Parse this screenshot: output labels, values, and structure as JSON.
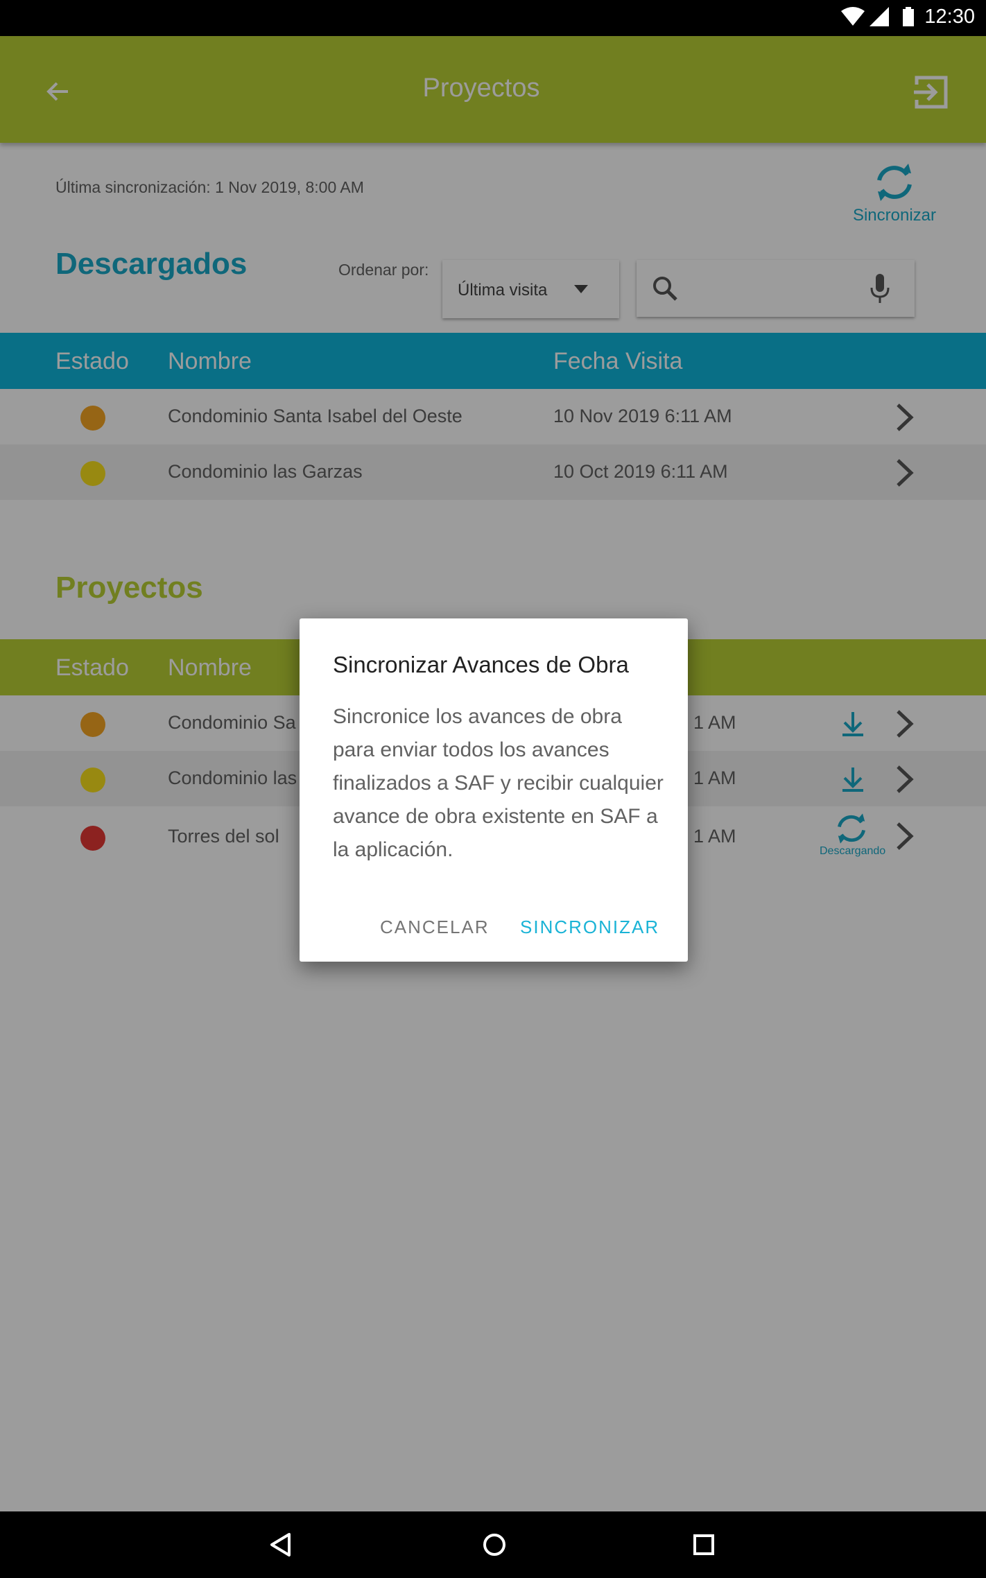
{
  "status_bar": {
    "time": "12:30"
  },
  "app_bar": {
    "title": "Proyectos"
  },
  "sync": {
    "last_sync": "Última sincronización: 1 Nov 2019, 8:00 AM",
    "button_label": "Sincronizar"
  },
  "downloaded": {
    "title": "Descargados",
    "order_label": "Ordenar por:",
    "order_value": "Última visita",
    "headers": {
      "estado": "Estado",
      "nombre": "Nombre",
      "fecha": "Fecha Visita"
    },
    "rows": [
      {
        "status_color": "#f5a623",
        "name": "Condominio Santa Isabel del Oeste",
        "date": "10 Nov 2019 6:11 AM"
      },
      {
        "status_color": "#f8e01c",
        "name": "Condominio las Garzas",
        "date": "10 Oct 2019 6:11 AM"
      }
    ]
  },
  "projects": {
    "title": "Proyectos",
    "headers": {
      "estado": "Estado",
      "nombre": "Nombre"
    },
    "rows": [
      {
        "status_color": "#f5a623",
        "name": "Condominio Sa",
        "date": "1 AM",
        "action": "download-icon"
      },
      {
        "status_color": "#f8e01c",
        "name": "Condominio las",
        "date": "1 AM",
        "action": "download-icon"
      },
      {
        "status_color": "#e53935",
        "name": "Torres del sol",
        "date": "1 AM",
        "action": "sync-icon",
        "action_label": "Descargando"
      }
    ]
  },
  "dialog": {
    "title": "Sincronizar Avances de Obra",
    "body": "Sincronice los avances de obra para enviar todos los avances finalizados a SAF y recibir cualquier avance de obra existente en SAF a la aplicación.",
    "cancel": "CANCELAR",
    "confirm": "SINCRONIZAR"
  },
  "colors": {
    "app_bar": "#b9d035",
    "downloaded_header": "#0fb5dc",
    "projects_header": "#b9d035",
    "accent": "#1aa8c8"
  }
}
